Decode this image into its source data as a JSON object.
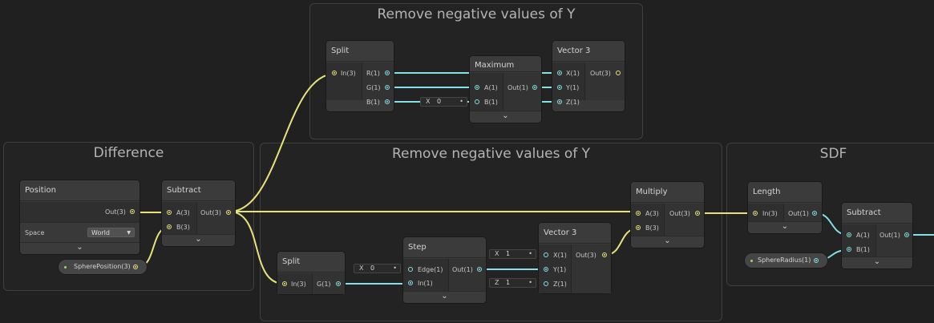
{
  "groups": {
    "remove_top": "Remove negative values of Y",
    "difference": "Difference",
    "remove_bottom": "Remove negative values of Y",
    "sdf": "SDF"
  },
  "nodes": {
    "split_top": {
      "title": "Split",
      "in": "In(3)",
      "r": "R(1)",
      "g": "G(1)",
      "b": "B(1)"
    },
    "maximum": {
      "title": "Maximum",
      "a": "A(1)",
      "b": "B(1)",
      "out": "Out(1)"
    },
    "vector3_top": {
      "title": "Vector 3",
      "x": "X(1)",
      "y": "Y(1)",
      "z": "Z(1)",
      "out": "Out(3)"
    },
    "position": {
      "title": "Position",
      "out": "Out(3)",
      "space_label": "Space",
      "space_value": "World"
    },
    "subtract_left": {
      "title": "Subtract",
      "a": "A(3)",
      "b": "B(3)",
      "out": "Out(3)"
    },
    "split_bottom": {
      "title": "Split",
      "in": "In(3)",
      "g": "G(1)"
    },
    "step": {
      "title": "Step",
      "edge": "Edge(1)",
      "in": "In(1)",
      "out": "Out(1)"
    },
    "vector3_bottom": {
      "title": "Vector 3",
      "x": "X(1)",
      "y": "Y(1)",
      "z": "Z(1)",
      "out": "Out(3)"
    },
    "multiply": {
      "title": "Multiply",
      "a": "A(3)",
      "b": "B(3)",
      "out": "Out(3)"
    },
    "length": {
      "title": "Length",
      "in": "In(3)",
      "out": "Out(1)"
    },
    "subtract_right": {
      "title": "Subtract",
      "a": "A(1)",
      "b": "B(1)",
      "out": "Out(1)"
    }
  },
  "fields": {
    "maximum_b": {
      "label": "X",
      "value": "0"
    },
    "step_edge": {
      "label": "X",
      "value": "0"
    },
    "vec_bottom_x": {
      "label": "X",
      "value": "1"
    },
    "vec_bottom_z": {
      "label": "Z",
      "value": "1"
    }
  },
  "properties": {
    "sphere_position": "SpherePosition(3)",
    "sphere_radius": "SphereRadius(1)"
  },
  "colors": {
    "vector3_wire": "#e8e27a",
    "float_wire": "#84e0e6",
    "background": "#202020",
    "node": "#393939"
  },
  "icons": {
    "collapse": "chevron-down-icon",
    "dropdown": "caret-down-icon"
  }
}
